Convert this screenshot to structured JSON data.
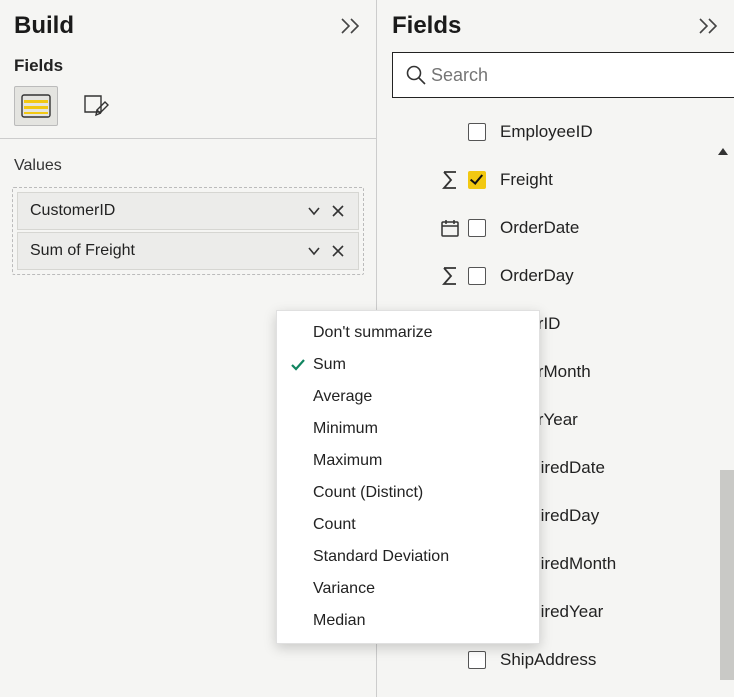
{
  "build": {
    "title": "Build",
    "fields_label": "Fields",
    "values_label": "Values",
    "value_chips": [
      {
        "label": "CustomerID"
      },
      {
        "label": "Sum of Freight"
      }
    ]
  },
  "menu": {
    "items": [
      {
        "label": "Don't summarize",
        "checked": false
      },
      {
        "label": "Sum",
        "checked": true
      },
      {
        "label": "Average",
        "checked": false
      },
      {
        "label": "Minimum",
        "checked": false
      },
      {
        "label": "Maximum",
        "checked": false
      },
      {
        "label": "Count (Distinct)",
        "checked": false
      },
      {
        "label": "Standard Deviation",
        "checked": false
      },
      {
        "label": "Count",
        "checked": false
      },
      {
        "label": "Variance",
        "checked": false
      },
      {
        "label": "Median",
        "checked": false
      }
    ]
  },
  "fields_pane": {
    "title": "Fields",
    "search_placeholder": "Search",
    "fields": [
      {
        "label": "EmployeeID",
        "type": "",
        "checked": false
      },
      {
        "label": "Freight",
        "type": "sigma",
        "checked": true
      },
      {
        "label": "OrderDate",
        "type": "date",
        "checked": false
      },
      {
        "label": "OrderDay",
        "type": "sigma",
        "checked": false
      },
      {
        "label": "OrderID",
        "type": "",
        "checked": false
      },
      {
        "label": "OrderMonth",
        "type": "",
        "checked": false
      },
      {
        "label": "OrderYear",
        "type": "",
        "checked": false
      },
      {
        "label": "RequiredDate",
        "type": "",
        "checked": false
      },
      {
        "label": "RequiredDay",
        "type": "",
        "checked": false
      },
      {
        "label": "RequiredMonth",
        "type": "",
        "checked": false
      },
      {
        "label": "RequiredYear",
        "type": "",
        "checked": false
      },
      {
        "label": "ShipAddress",
        "type": "",
        "checked": false
      }
    ]
  }
}
